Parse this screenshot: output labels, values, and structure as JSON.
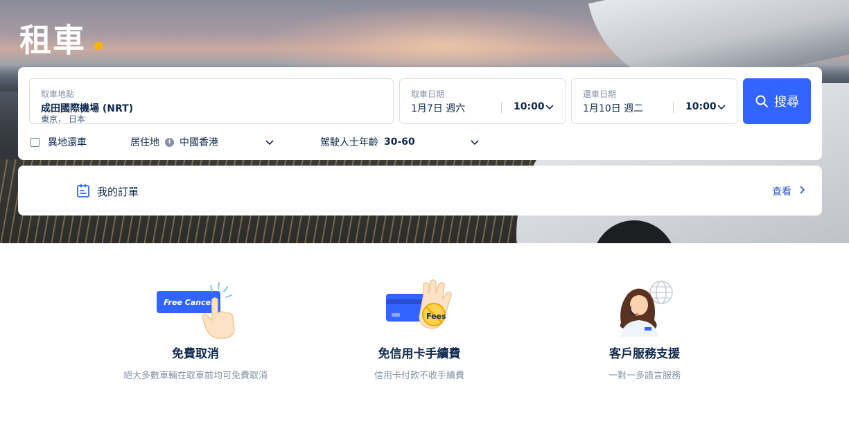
{
  "header": {
    "title": "租車"
  },
  "search": {
    "pickup_location_label": "取車地點",
    "pickup_location_value": "成田國際機場 (NRT)",
    "pickup_location_sub": "東京， 日本",
    "pickup_date_label": "取車日期",
    "pickup_date_value": "1月7日 週六",
    "pickup_time_value": "10:00",
    "return_date_label": "還車日期",
    "return_date_value": "1月10日 週二",
    "return_time_value": "10:00",
    "search_button_label": "搜尋",
    "different_return_label": "異地還車",
    "residence_label": "居住地",
    "residence_value": "中國香港",
    "driver_age_label": "駕駛人士年齡",
    "driver_age_value": "30-60"
  },
  "orders": {
    "label": "我的訂單",
    "view_link": "查看"
  },
  "features": [
    {
      "title": "免費取消",
      "desc": "絕大多數車輛在取車前均可免費取消",
      "badge": "Free Cancel"
    },
    {
      "title": "免信用卡手續費",
      "desc": "信用卡付款不收手續費",
      "badge": "Fees"
    },
    {
      "title": "客戶服務支援",
      "desc": "一對一多語言服務"
    }
  ],
  "colors": {
    "primary": "#3264ff",
    "accent_dot": "#ffb300",
    "text_dark": "#0f294d",
    "text_muted": "#8592a6",
    "link": "#2e56c8"
  }
}
